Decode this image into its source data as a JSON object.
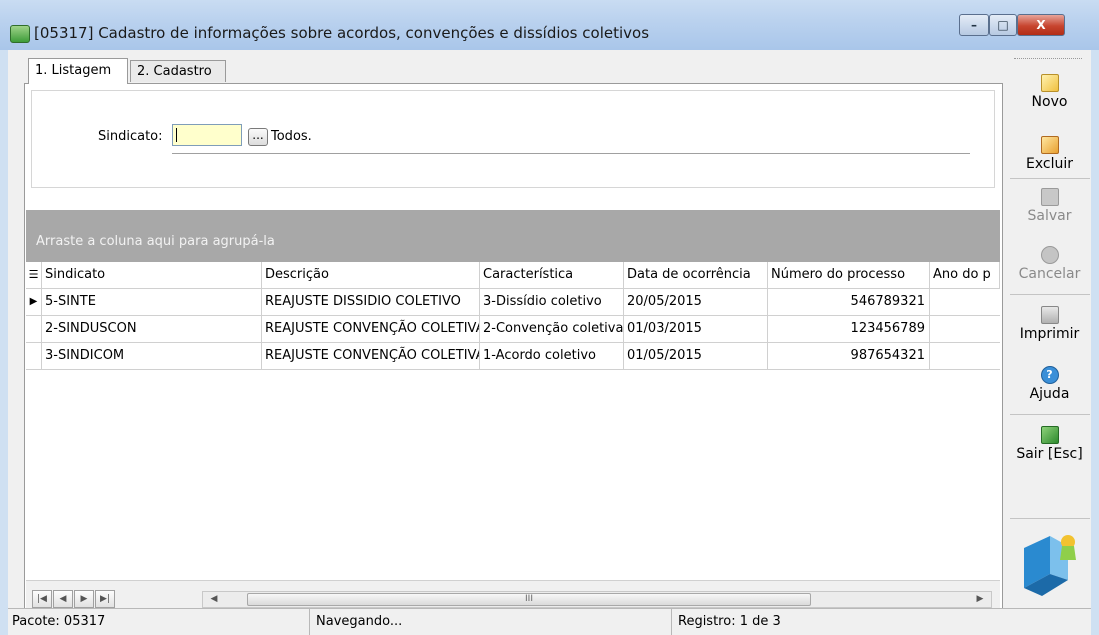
{
  "window": {
    "title": "[05317] Cadastro de informações sobre acordos, convenções e dissídios coletivos",
    "minimize": "–",
    "maximize": "□",
    "close": "X"
  },
  "tabs": [
    {
      "label": "1. Listagem",
      "selected": true
    },
    {
      "label": "2. Cadastro",
      "selected": false
    }
  ],
  "filter": {
    "label": "Sindicato:",
    "value": "",
    "lookup_label": "...",
    "all_label": "Todos."
  },
  "grid": {
    "group_hint": "Arraste a coluna aqui para agrupá-la",
    "columns": [
      "Sindicato",
      "Descrição",
      "Característica",
      "Data de ocorrência",
      "Número do processo",
      "Ano do p"
    ],
    "rows": [
      {
        "sindicato": "5-SINTE",
        "descricao": "REAJUSTE DISSIDIO COLETIVO",
        "caracteristica": "3-Dissídio coletivo",
        "data": "20/05/2015",
        "processo": "546789321",
        "ano": ""
      },
      {
        "sindicato": "2-SINDUSCON",
        "descricao": "REAJUSTE CONVENÇÃO COLETIVA",
        "caracteristica": "2-Convenção coletiva",
        "data": "01/03/2015",
        "processo": "123456789",
        "ano": ""
      },
      {
        "sindicato": "3-SINDICOM",
        "descricao": "REAJUSTE CONVENÇÃO COLETIVA",
        "caracteristica": "1-Acordo coletivo",
        "data": "01/05/2015",
        "processo": "987654321",
        "ano": ""
      }
    ],
    "current_row_indicator": "▶",
    "scroll_thumb": "III"
  },
  "toolbar": {
    "novo": "Novo",
    "excluir": "Excluir",
    "salvar": "Salvar",
    "cancelar": "Cancelar",
    "imprimir": "Imprimir",
    "ajuda": "Ajuda",
    "sair": "Sair [Esc]"
  },
  "status": {
    "pacote": "Pacote: 05317",
    "estado": "Navegando...",
    "registro": "Registro: 1 de 3"
  }
}
